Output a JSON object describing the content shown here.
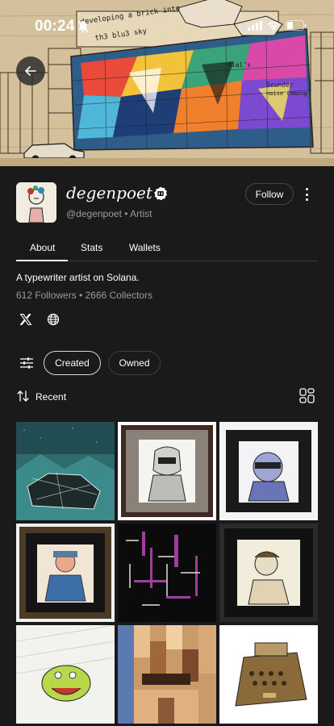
{
  "status_bar": {
    "time": "00:24"
  },
  "profile": {
    "name": "degenpoet",
    "handle": "@degenpoet",
    "separator": "•",
    "role": "Artist",
    "follow_label": "Follow"
  },
  "tabs": [
    {
      "label": "About"
    },
    {
      "label": "Stats"
    },
    {
      "label": "Wallets"
    }
  ],
  "about": {
    "bio": "A typewriter artist on Solana.",
    "followers": "612 Followers",
    "collectors": "2666 Collectors",
    "stats_separator": "•"
  },
  "filters": {
    "created_label": "Created",
    "owned_label": "Owned",
    "sort_label": "Recent"
  },
  "banner_text": [
    "developing a brick into",
    "th3 blu3 sky",
    "dial’s",
    "Scunder",
    "noise coming"
  ],
  "icons": [
    "back-arrow-icon",
    "verified-badge-icon",
    "more-vertical-icon",
    "x-logo-icon",
    "globe-icon",
    "filter-sliders-icon",
    "sort-icon",
    "layout-toggle-icon",
    "mute-bell-icon",
    "signal-icon",
    "wifi-icon",
    "battery-icon"
  ],
  "colors": {
    "background": "#1a1a1a",
    "text_primary": "#ffffff",
    "text_secondary": "#9a9a9a",
    "divider": "#3a3a3a"
  }
}
